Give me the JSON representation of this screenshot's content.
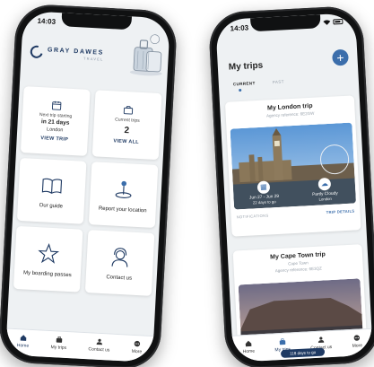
{
  "left_phone": {
    "status": {
      "time": "14:03"
    },
    "brand": {
      "name": "GRAY DAWES",
      "sub": "TRAVEL"
    },
    "next_trip": {
      "label": "Next trip starting",
      "when": "in 21 days",
      "city": "London",
      "link": "VIEW TRIP"
    },
    "current_trips": {
      "label": "Current trips",
      "count": "2",
      "link": "VIEW ALL"
    },
    "tiles": [
      {
        "label": "Our guide",
        "icon": "book-icon"
      },
      {
        "label": "Report your location",
        "icon": "location-pin-icon"
      },
      {
        "label": "My boarding passes",
        "icon": "star-icon"
      },
      {
        "label": "Contact us",
        "icon": "headset-icon"
      }
    ],
    "tabbar": [
      {
        "label": "Home",
        "icon": "home-icon"
      },
      {
        "label": "My trips",
        "icon": "suitcase-icon"
      },
      {
        "label": "Contact us",
        "icon": "person-icon"
      },
      {
        "label": "More",
        "icon": "more-icon"
      }
    ]
  },
  "right_phone": {
    "status": {
      "time": "14:03"
    },
    "title": "My trips",
    "add_label": "+",
    "segments": {
      "current": "CURRENT",
      "past": "PAST"
    },
    "london_trip": {
      "name": "My London trip",
      "ref": "Agency reference: 6E2GW",
      "dates": "Jun 27 - Jun 29",
      "countdown": "22 days to go",
      "weather": "Partly Cloudy",
      "city": "London",
      "notifications": "NOTIFICATIONS",
      "details": "TRIP DETAILS"
    },
    "cape_trip": {
      "name": "My Cape Town trip",
      "city": "Cape Town",
      "ref": "Agency reference: 6E3QZ"
    },
    "tabbar": [
      {
        "label": "Home",
        "icon": "home-icon"
      },
      {
        "label": "My trips",
        "icon": "suitcase-icon"
      },
      {
        "label": "Contact us",
        "icon": "person-icon"
      },
      {
        "label": "More",
        "icon": "more-icon"
      }
    ],
    "days_pill": "118 days to go"
  },
  "colors": {
    "brand_navy": "#1f3a63",
    "accent_blue": "#3b6eab",
    "screen_bg": "#eef1f3"
  }
}
